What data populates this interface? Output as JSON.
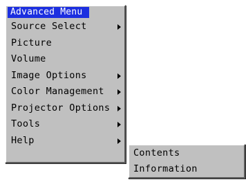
{
  "menu": {
    "title": "Advanced Menu",
    "title_bg_color": "#1c2fe0",
    "background_color": "#c0c0c0",
    "items": [
      {
        "label": "Source Select",
        "has_submenu": true
      },
      {
        "label": "Picture",
        "has_submenu": false
      },
      {
        "label": "Volume",
        "has_submenu": false
      },
      {
        "label": "Image Options",
        "has_submenu": true
      },
      {
        "label": "Color Management",
        "has_submenu": true
      },
      {
        "label": "Projector Options",
        "has_submenu": true
      },
      {
        "label": "Tools",
        "has_submenu": true
      },
      {
        "label": "Help",
        "has_submenu": true
      }
    ]
  },
  "submenu": {
    "parent": "Help",
    "items": [
      {
        "label": "Contents"
      },
      {
        "label": "Information"
      }
    ]
  }
}
